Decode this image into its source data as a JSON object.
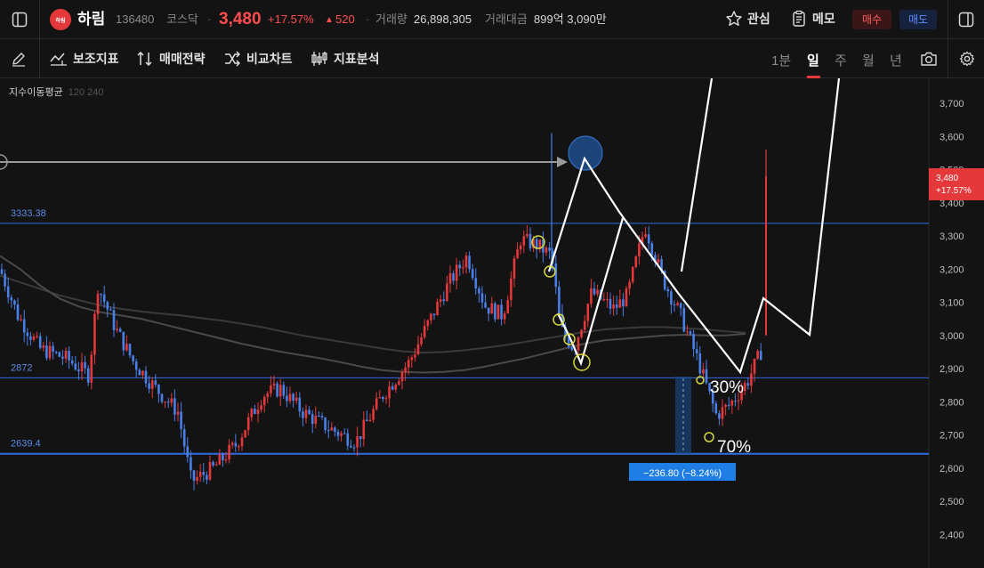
{
  "stock": {
    "logo_text": "하림",
    "name": "하림",
    "code": "136480",
    "market": "코스닥",
    "price": "3,480",
    "change_pct": "+17.57%",
    "change_arrow": "▲",
    "change_abs": "520",
    "volume_label": "거래량",
    "volume": "26,898,305",
    "amount_label": "거래대금",
    "amount": "899억 3,090만"
  },
  "actions": {
    "watch": "관심",
    "memo": "메모",
    "buy": "매수",
    "sell": "매도"
  },
  "toolbar": {
    "indicators": "보조지표",
    "strategy": "매매전략",
    "compare": "비교차트",
    "analysis": "지표분석",
    "intervals": [
      "1분",
      "일",
      "주",
      "월",
      "년"
    ],
    "active_interval": "일"
  },
  "indicator_legend": {
    "name": "지수이동평균",
    "params": "120 240"
  },
  "colors": {
    "up": "#e5383b",
    "down": "#4a7fe8",
    "bg": "#131313",
    "hline": "#2f6de0",
    "accent_buy": "#ff5a5a",
    "accent_sell": "#5a8cff"
  },
  "chart_data": {
    "type": "candlestick",
    "ylim": [
      2360,
      3780
    ],
    "y_ticks": [
      "3,700",
      "3,600",
      "3,500",
      "3,400",
      "3,300",
      "3,200",
      "3,100",
      "3,000",
      "2,900",
      "2,800",
      "2,700",
      "2,600",
      "2,500",
      "2,400"
    ],
    "price_tag": {
      "price": "3,480",
      "pct": "+17.57%"
    },
    "horizontal_lines": [
      {
        "label": "3333.38",
        "value": 3338
      },
      {
        "label": "2872",
        "value": 2872
      },
      {
        "label": "2639.4",
        "value": 2643
      }
    ],
    "measure": {
      "label": "−236.80  (−8.24%)"
    },
    "annotations": [
      "30%",
      "70%"
    ],
    "ma": {
      "ma120": [
        3240,
        3200,
        3150,
        3110,
        3085,
        3070,
        3060,
        3050,
        3035,
        3020,
        3005,
        2990,
        2975,
        2962,
        2950,
        2940,
        2930,
        2918,
        2905,
        2895,
        2890,
        2888,
        2890,
        2895,
        2905,
        2918,
        2930,
        2945,
        2960,
        2975,
        2985,
        2990,
        2995,
        3000,
        3002,
        3000,
        3000,
        3005
      ],
      "ma240": [
        3180,
        3160,
        3140,
        3120,
        3105,
        3090,
        3080,
        3072,
        3066,
        3060,
        3052,
        3045,
        3035,
        3025,
        3012,
        3000,
        2990,
        2980,
        2970,
        2960,
        2952,
        2948,
        2950,
        2955,
        2962,
        2970,
        2980,
        2990,
        3000,
        3010,
        3018,
        3022,
        3025,
        3025,
        3022,
        3018,
        3012,
        3008
      ]
    }
  }
}
